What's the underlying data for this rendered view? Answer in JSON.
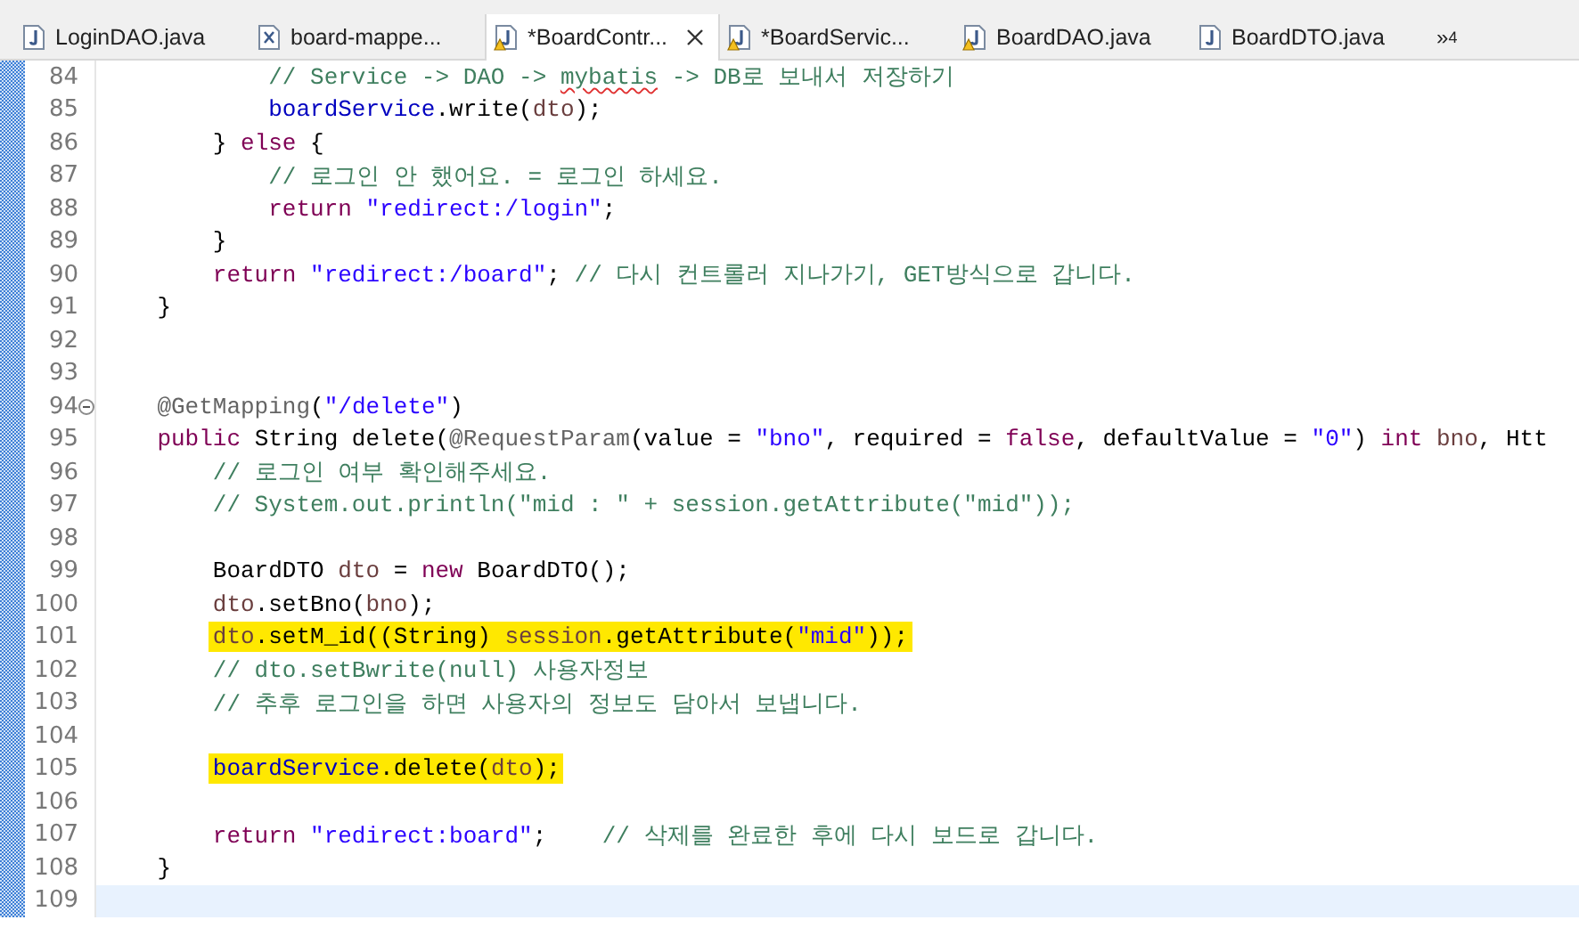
{
  "tabs": [
    {
      "label": "LoginDAO.java",
      "kind": "java",
      "warning": false,
      "selected": false
    },
    {
      "label": "board-mappe...",
      "kind": "xml",
      "warning": false,
      "selected": false
    },
    {
      "label": "*BoardContr...",
      "kind": "java",
      "warning": true,
      "selected": true
    },
    {
      "label": "*BoardServic...",
      "kind": "java",
      "warning": true,
      "selected": false
    },
    {
      "label": "BoardDAO.java",
      "kind": "java",
      "warning": true,
      "selected": false
    },
    {
      "label": "BoardDTO.java",
      "kind": "java",
      "warning": false,
      "selected": false
    }
  ],
  "overflow": {
    "chevron": "»",
    "count": "4"
  },
  "lines": [
    {
      "n": "84",
      "tokens": [
        {
          "kind": "com",
          "text": "            // Service -> DAO -> "
        },
        {
          "kind": "com",
          "text": "mybatis",
          "squiggle": true
        },
        {
          "kind": "com",
          "text": " -> DB로 보내서 저장하기"
        }
      ]
    },
    {
      "n": "85",
      "tokens": [
        {
          "kind": "field",
          "text": "            boardService"
        },
        {
          "kind": "plain",
          "text": ".write("
        },
        {
          "kind": "local",
          "text": "dto"
        },
        {
          "kind": "plain",
          "text": ");"
        }
      ]
    },
    {
      "n": "86",
      "tokens": [
        {
          "kind": "plain",
          "text": "        } "
        },
        {
          "kind": "kw",
          "text": "else"
        },
        {
          "kind": "plain",
          "text": " {"
        }
      ]
    },
    {
      "n": "87",
      "tokens": [
        {
          "kind": "com",
          "text": "            // 로그인 안 했어요. = 로그인 하세요."
        }
      ]
    },
    {
      "n": "88",
      "tokens": [
        {
          "kind": "kw",
          "text": "            return"
        },
        {
          "kind": "str",
          "text": " \"redirect:/login\""
        },
        {
          "kind": "plain",
          "text": ";"
        }
      ]
    },
    {
      "n": "89",
      "tokens": [
        {
          "kind": "plain",
          "text": "        }"
        }
      ]
    },
    {
      "n": "90",
      "tokens": [
        {
          "kind": "kw",
          "text": "        return"
        },
        {
          "kind": "str",
          "text": " \"redirect:/board\""
        },
        {
          "kind": "plain",
          "text": ";"
        },
        {
          "kind": "com",
          "text": " // 다시 컨트롤러 지나가기, GET방식으로 갑니다."
        }
      ]
    },
    {
      "n": "91",
      "tokens": [
        {
          "kind": "plain",
          "text": "    }"
        }
      ]
    },
    {
      "n": "92"
    },
    {
      "n": "93"
    },
    {
      "n": "94",
      "foldable": true,
      "tokens": [
        {
          "kind": "ann",
          "text": "    @GetMapping"
        },
        {
          "kind": "plain",
          "text": "("
        },
        {
          "kind": "str",
          "text": "\"/delete\""
        },
        {
          "kind": "plain",
          "text": ")"
        }
      ]
    },
    {
      "n": "95",
      "tokens": [
        {
          "kind": "kw",
          "text": "    public"
        },
        {
          "kind": "plain",
          "text": " String delete("
        },
        {
          "kind": "ann",
          "text": "@RequestParam"
        },
        {
          "kind": "plain",
          "text": "(value = "
        },
        {
          "kind": "str",
          "text": "\"bno\""
        },
        {
          "kind": "plain",
          "text": ", required = "
        },
        {
          "kind": "kw",
          "text": "false"
        },
        {
          "kind": "plain",
          "text": ", defaultValue = "
        },
        {
          "kind": "str",
          "text": "\"0\""
        },
        {
          "kind": "plain",
          "text": ") "
        },
        {
          "kind": "kw",
          "text": "int"
        },
        {
          "kind": "local",
          "text": " bno"
        },
        {
          "kind": "plain",
          "text": ", Htt"
        }
      ]
    },
    {
      "n": "96",
      "tokens": [
        {
          "kind": "com",
          "text": "        // 로그인 여부 확인해주세요."
        }
      ]
    },
    {
      "n": "97",
      "tokens": [
        {
          "kind": "com",
          "text": "        // System.out.println(\"mid : \" + session.getAttribute(\"mid\"));"
        }
      ]
    },
    {
      "n": "98"
    },
    {
      "n": "99",
      "tokens": [
        {
          "kind": "plain",
          "text": "        BoardDTO "
        },
        {
          "kind": "local",
          "text": "dto"
        },
        {
          "kind": "plain",
          "text": " = "
        },
        {
          "kind": "kw",
          "text": "new"
        },
        {
          "kind": "plain",
          "text": " BoardDTO();"
        }
      ]
    },
    {
      "n": "100",
      "tokens": [
        {
          "kind": "local",
          "text": "        dto"
        },
        {
          "kind": "plain",
          "text": ".setBno("
        },
        {
          "kind": "local",
          "text": "bno"
        },
        {
          "kind": "plain",
          "text": ");"
        }
      ]
    },
    {
      "n": "101",
      "marked": true,
      "tokens": [
        {
          "kind": "local",
          "text": "        dto"
        },
        {
          "kind": "plain",
          "text": ".setM_id((String) "
        },
        {
          "kind": "local",
          "text": "session"
        },
        {
          "kind": "plain",
          "text": ".getAttribute("
        },
        {
          "kind": "str",
          "text": "\"mid\""
        },
        {
          "kind": "plain",
          "text": "));"
        }
      ]
    },
    {
      "n": "102",
      "tokens": [
        {
          "kind": "com",
          "text": "        // dto.setBwrite(null) 사용자정보"
        }
      ]
    },
    {
      "n": "103",
      "tokens": [
        {
          "kind": "com",
          "text": "        // 추후 로그인을 하면 사용자의 정보도 담아서 보냅니다."
        }
      ]
    },
    {
      "n": "104"
    },
    {
      "n": "105",
      "marked": true,
      "tokens": [
        {
          "kind": "field",
          "text": "        boardService"
        },
        {
          "kind": "plain",
          "text": ".delete("
        },
        {
          "kind": "local",
          "text": "dto"
        },
        {
          "kind": "plain",
          "text": ");"
        }
      ]
    },
    {
      "n": "106"
    },
    {
      "n": "107",
      "tokens": [
        {
          "kind": "kw",
          "text": "        return"
        },
        {
          "kind": "str",
          "text": " \"redirect:board\""
        },
        {
          "kind": "plain",
          "text": ";"
        },
        {
          "kind": "com",
          "text": "    // 삭제를 완료한 후에 다시 보드로 갑니다."
        }
      ]
    },
    {
      "n": "108",
      "tokens": [
        {
          "kind": "plain",
          "text": "    }"
        }
      ]
    },
    {
      "n": "109",
      "current": true
    }
  ]
}
